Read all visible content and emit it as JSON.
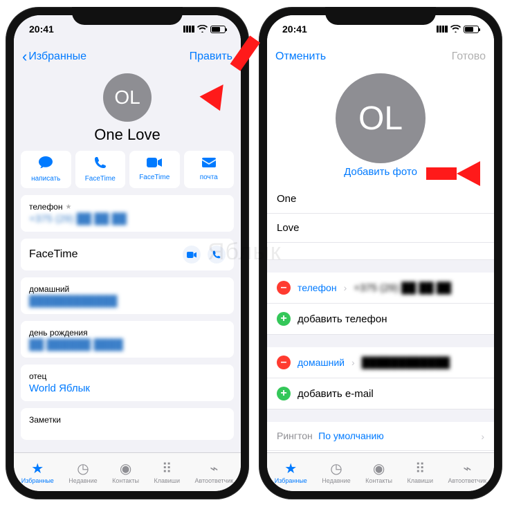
{
  "status": {
    "time": "20:41"
  },
  "left": {
    "back": "Избранные",
    "edit": "Править",
    "initials": "OL",
    "name": "One Love",
    "actions": {
      "write": "написать",
      "ft_audio": "FaceTime",
      "ft_video": "FaceTime",
      "mail": "почта"
    },
    "phone_label": "телефон",
    "phone_value": "+375 (29) ██ ██ ██",
    "facetime_label": "FaceTime",
    "home_label": "домашний",
    "home_value": "████████████",
    "bday_label": "день рождения",
    "bday_value": "██ ██████ ████",
    "father_label": "отец",
    "father_value": "World Яблык",
    "notes_label": "Заметки"
  },
  "right": {
    "cancel": "Отменить",
    "done": "Готово",
    "initials": "OL",
    "add_photo": "Добавить фото",
    "first": "One",
    "last": "Love",
    "phone_field": "телефон",
    "phone_value": "+375 (29) ██ ██ ██",
    "add_phone": "добавить телефон",
    "home_field": "домашний",
    "home_value": "████████████",
    "add_email": "добавить e-mail",
    "ringtone_label": "Рингтон",
    "ringtone_value": "По умолчанию"
  },
  "tabs": {
    "fav": "Избранные",
    "recent": "Недавние",
    "contacts": "Контакты",
    "keypad": "Клавиши",
    "voicemail": "Автоответчик"
  },
  "watermark": "Яблык"
}
